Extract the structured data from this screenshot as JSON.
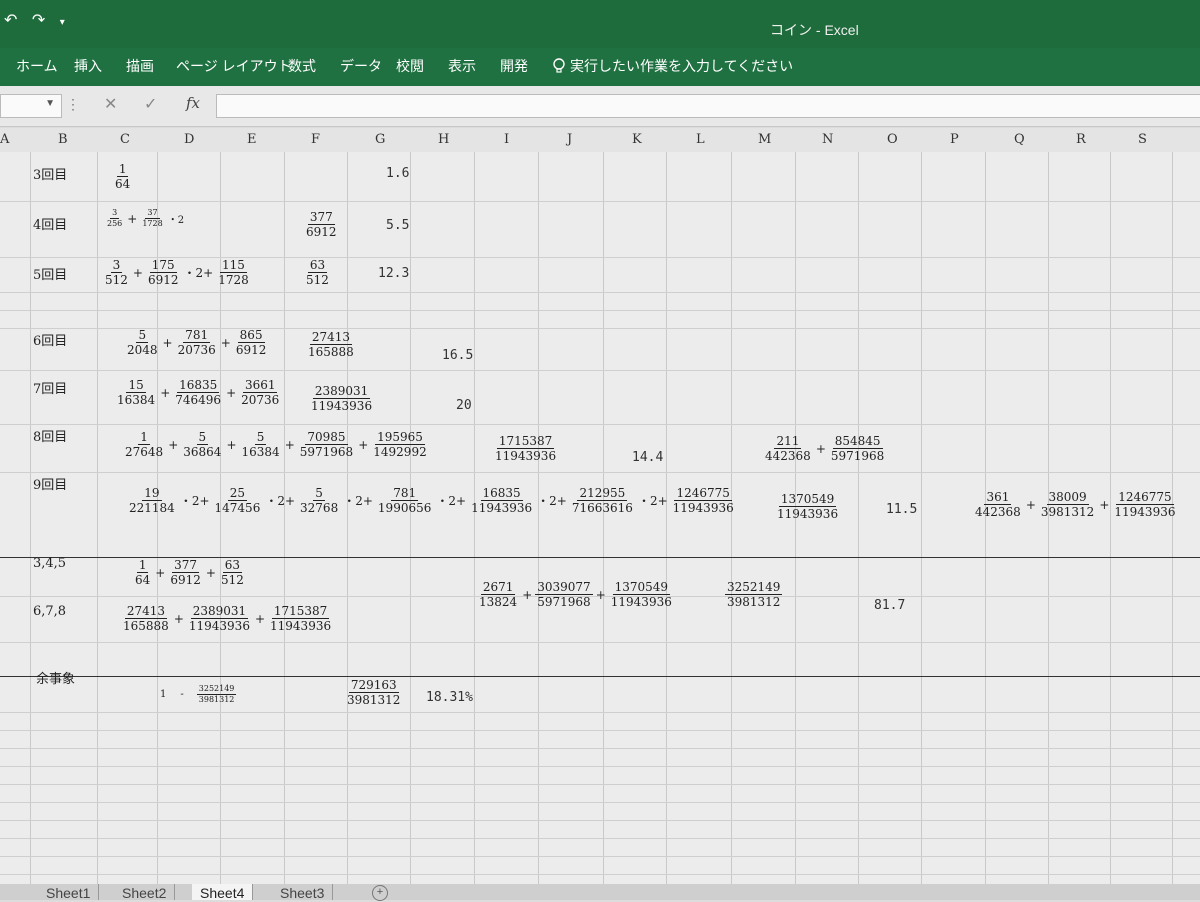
{
  "app": {
    "title": "コイン - Excel"
  },
  "qat": {
    "undo_glyph": "↶",
    "redo_glyph": "↷",
    "more_glyph": "▾"
  },
  "ribbon": {
    "tabs": [
      "ホーム",
      "挿入",
      "描画",
      "ページ レイアウト",
      "数式",
      "データ",
      "校閲",
      "表示",
      "開発"
    ],
    "tell_me": "実行したい作業を入力してください"
  },
  "formula_bar": {
    "cancel": "✕",
    "enter": "✓",
    "fx": "fx",
    "name_box": "",
    "formula": ""
  },
  "columns": [
    "A",
    "B",
    "C",
    "D",
    "E",
    "F",
    "G",
    "H",
    "I",
    "J",
    "K",
    "L",
    "M",
    "N",
    "O",
    "P",
    "Q",
    "R",
    "S"
  ],
  "cells": {
    "row_labels": [
      "3回目",
      "4回目",
      "5回目",
      "6回目",
      "7回目",
      "8回目",
      "9回目",
      "3,4,5",
      "6,7,8",
      "余事象"
    ],
    "values": {
      "r3": "1.6",
      "r4": "5.5",
      "r5": "12.3",
      "r6": "16.5",
      "r7": "20",
      "r8": "14.4",
      "r9": "11.5",
      "sum": "81.7",
      "comp": "18.31%"
    },
    "exprs": {
      "r3": [
        [
          "1",
          "64"
        ]
      ],
      "r4": {
        "a": [
          "3",
          "256"
        ],
        "plus": "+",
        "b": [
          "37",
          "1728"
        ],
        "times": "・2"
      },
      "r4_result": [
        "377",
        "6912"
      ],
      "r5": {
        "a": [
          "3",
          "512"
        ],
        "b": [
          "175",
          "6912"
        ],
        "mid": "・2+",
        "c": [
          "115",
          "1728"
        ]
      },
      "r5_result": [
        "63",
        "512"
      ],
      "r6": {
        "a": [
          "5",
          "2048"
        ],
        "b": [
          "781",
          "20736"
        ],
        "c": [
          "865",
          "6912"
        ]
      },
      "r6_result": [
        "27413",
        "165888"
      ],
      "r7": {
        "a": [
          "15",
          "16384"
        ],
        "b": [
          "16835",
          "746496"
        ],
        "c": [
          "3661",
          "20736"
        ]
      },
      "r7_result": [
        "2389031",
        "11943936"
      ],
      "r8": {
        "a": [
          "1",
          "27648"
        ],
        "b": [
          "5",
          "36864"
        ],
        "c": [
          "5",
          "16384"
        ],
        "d": [
          "70985",
          "5971968"
        ],
        "e": [
          "195965",
          "1492992"
        ]
      },
      "r8_result": [
        "1715387",
        "11943936"
      ],
      "r8_alt": {
        "a": [
          "211",
          "442368"
        ],
        "b": [
          "854845",
          "5971968"
        ]
      },
      "r9": {
        "a": [
          "19",
          "221184"
        ],
        "b": [
          "25",
          "147456"
        ],
        "c": [
          "5",
          "32768"
        ],
        "d": [
          "781",
          "1990656"
        ],
        "e": [
          "16835",
          "11943936"
        ],
        "f": [
          "212955",
          "71663616"
        ],
        "g": [
          "1246775",
          "11943936"
        ],
        "mul": "・2+"
      },
      "r9_result": [
        "1370549",
        "11943936"
      ],
      "r9_alt": {
        "a": [
          "361",
          "442368"
        ],
        "b": [
          "38009",
          "3981312"
        ],
        "c": [
          "1246775",
          "11943936"
        ]
      },
      "s345": {
        "a": [
          "1",
          "64"
        ],
        "b": [
          "377",
          "6912"
        ],
        "c": [
          "63",
          "512"
        ]
      },
      "s678": {
        "a": [
          "27413",
          "165888"
        ],
        "b": [
          "2389031",
          "11943936"
        ],
        "c": [
          "1715387",
          "11943936"
        ]
      },
      "sum_mid": {
        "a": [
          "2671",
          "13824"
        ],
        "b": [
          "3039077",
          "5971968"
        ],
        "c": [
          "1370549",
          "11943936"
        ]
      },
      "sum_result": [
        "3252149",
        "3981312"
      ],
      "comp_expr": {
        "one": "1",
        "minus": "-",
        "a": [
          "3252149",
          "3981312"
        ]
      },
      "comp_result": [
        "729163",
        "3981312"
      ]
    }
  },
  "sheets": {
    "tabs": [
      "Sheet1",
      "Sheet2",
      "Sheet4",
      "Sheet3"
    ],
    "active": "Sheet4",
    "add": "+"
  }
}
